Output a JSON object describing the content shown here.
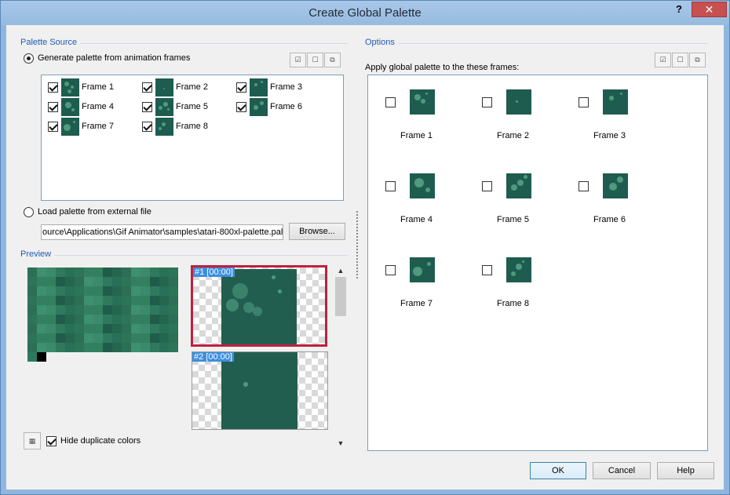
{
  "window": {
    "title": "Create Global Palette",
    "help_glyph": "?",
    "close_glyph": "✕"
  },
  "palette_source": {
    "title": "Palette Source",
    "generate_label": "Generate palette from animation frames",
    "frames": [
      {
        "label": "Frame 1",
        "checked": true
      },
      {
        "label": "Frame 2",
        "checked": true
      },
      {
        "label": "Frame 3",
        "checked": true
      },
      {
        "label": "Frame 4",
        "checked": true
      },
      {
        "label": "Frame 5",
        "checked": true
      },
      {
        "label": "Frame 6",
        "checked": true
      },
      {
        "label": "Frame 7",
        "checked": true
      },
      {
        "label": "Frame 8",
        "checked": true
      }
    ],
    "load_label": "Load palette from external file",
    "path_value": "ource\\Applications\\Gif Animator\\samples\\atari-800xl-palette.pal",
    "browse_label": "Browse..."
  },
  "preview": {
    "title": "Preview",
    "frames": [
      {
        "tag": "#1 [00:00]"
      },
      {
        "tag": "#2 [00:00]"
      }
    ],
    "hide_duplicates_label": "Hide duplicate colors"
  },
  "options": {
    "title": "Options",
    "apply_label": "Apply global palette to the these frames:",
    "frames": [
      {
        "label": "Frame 1",
        "checked": false
      },
      {
        "label": "Frame 2",
        "checked": false
      },
      {
        "label": "Frame 3",
        "checked": false
      },
      {
        "label": "Frame 4",
        "checked": false
      },
      {
        "label": "Frame 5",
        "checked": false
      },
      {
        "label": "Frame 6",
        "checked": false
      },
      {
        "label": "Frame 7",
        "checked": false
      },
      {
        "label": "Frame 8",
        "checked": false
      }
    ]
  },
  "buttons": {
    "ok": "OK",
    "cancel": "Cancel",
    "help": "Help"
  },
  "colors": {
    "accent": "#1f5bb3",
    "selection": "#c0203e",
    "frame_bg": "#1e5c4f",
    "bubble": "#4f9a7f"
  }
}
